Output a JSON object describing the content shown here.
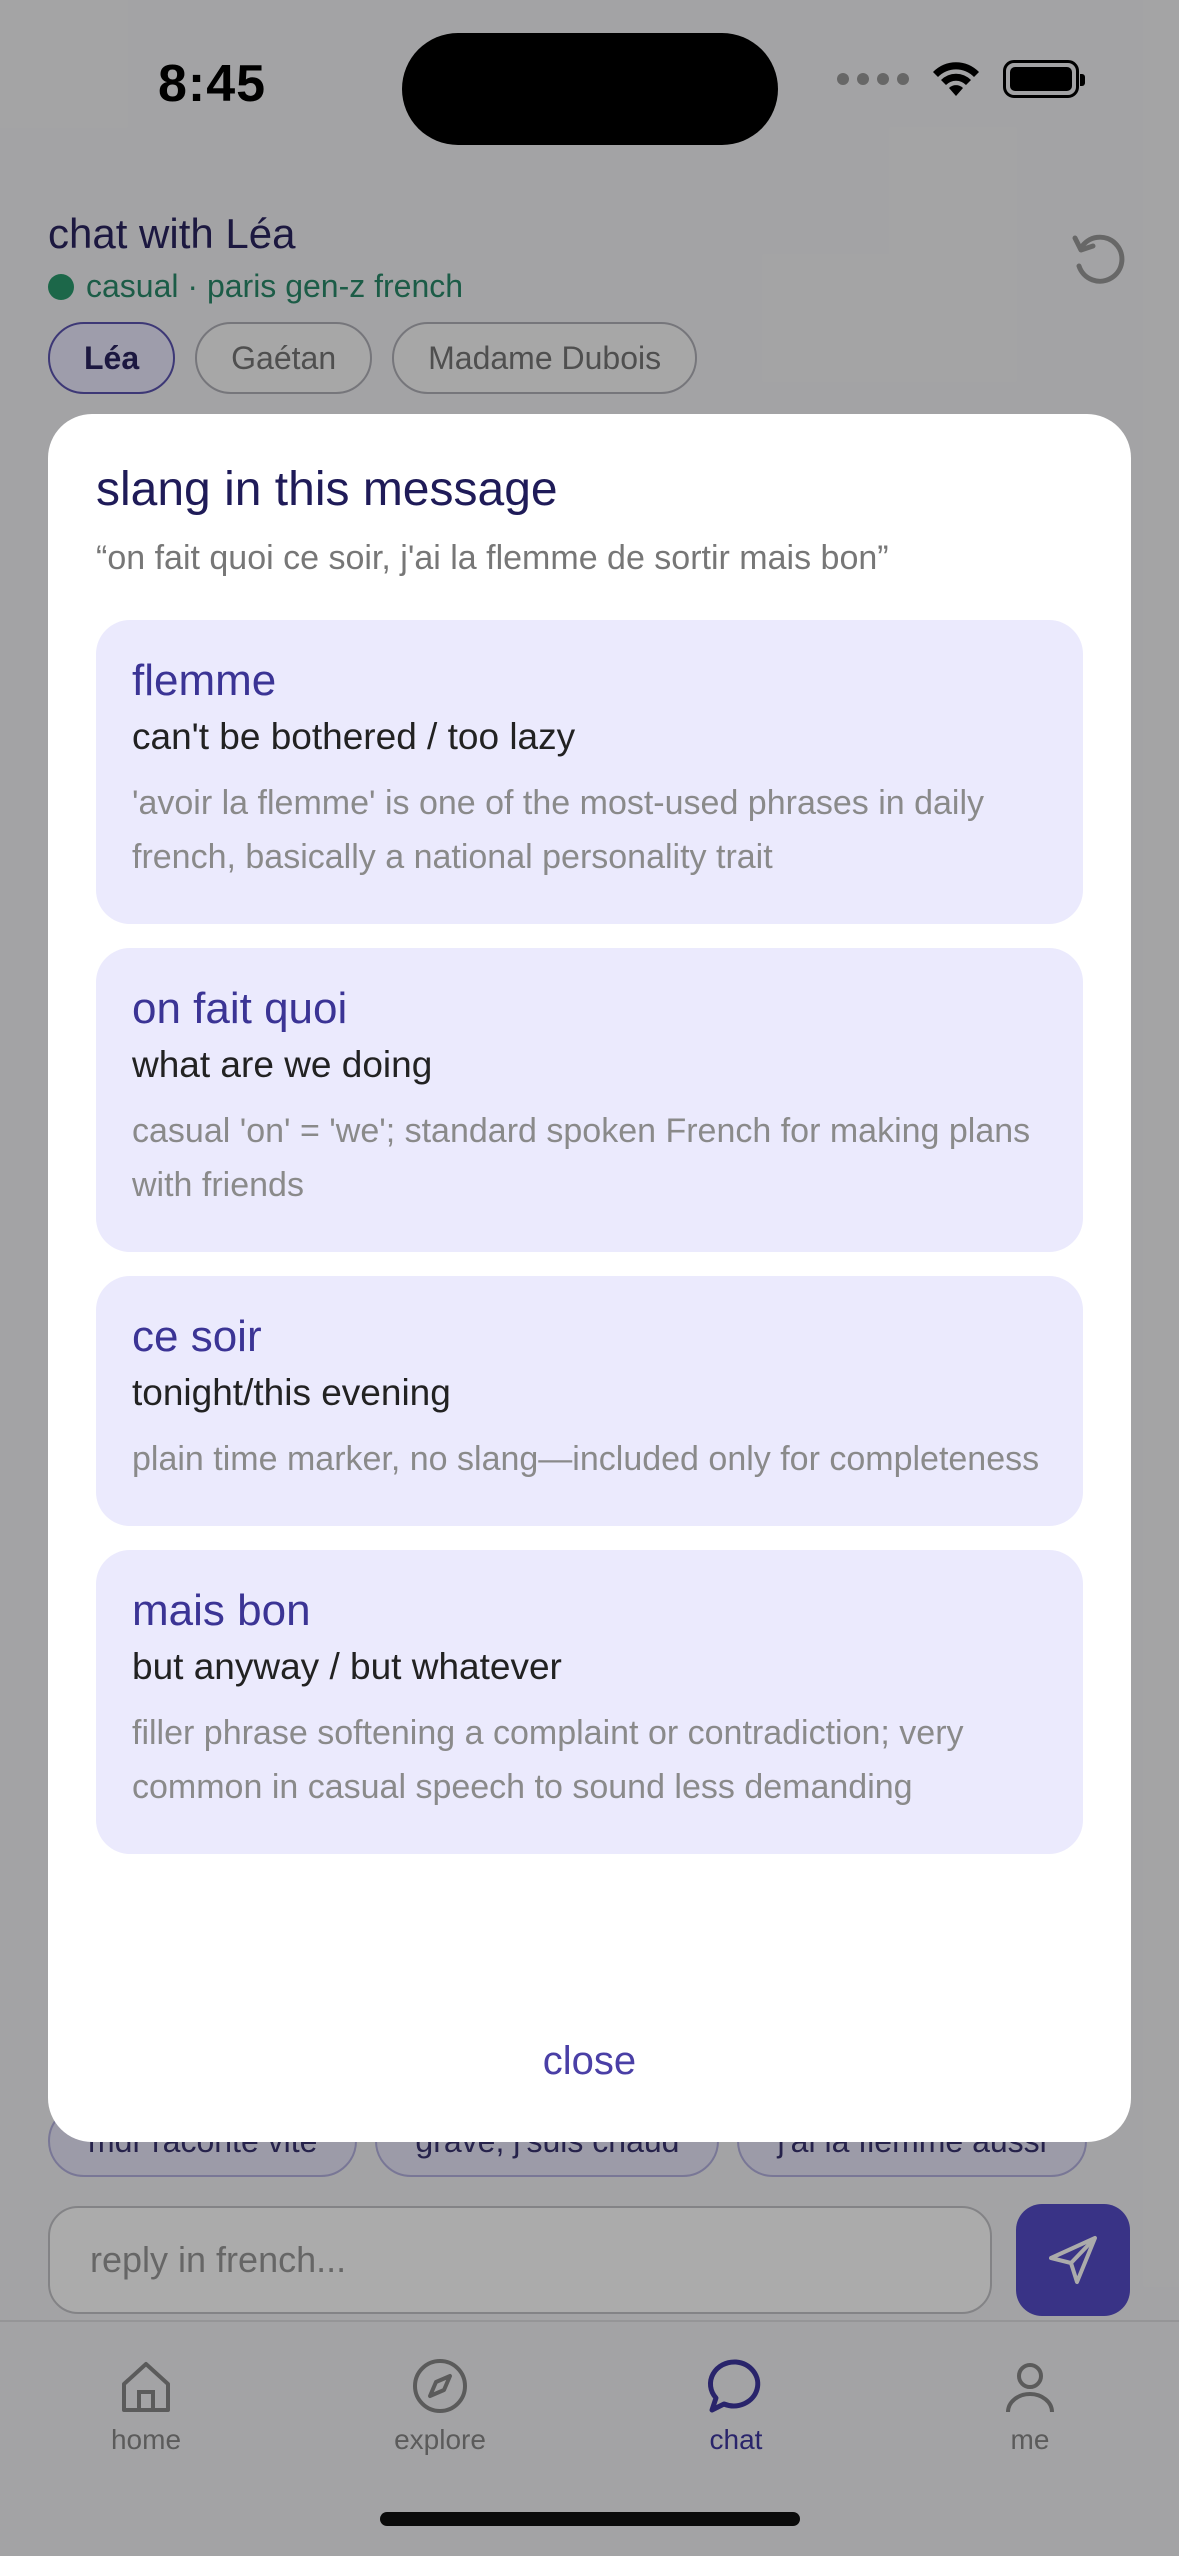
{
  "status_bar": {
    "time": "8:45"
  },
  "chat": {
    "title": "chat with Léa",
    "subtitle": "casual · paris gen-z french",
    "personas": [
      "Léa",
      "Gaétan",
      "Madame Dubois"
    ]
  },
  "suggestions": [
    "mdr raconte vite",
    "grave, j'suis chaud",
    "j'ai la flemme aussi"
  ],
  "composer": {
    "placeholder": "reply in french..."
  },
  "tabs": [
    {
      "label": "home",
      "icon": "home-icon"
    },
    {
      "label": "explore",
      "icon": "compass-icon"
    },
    {
      "label": "chat",
      "icon": "chat-bubble-icon"
    },
    {
      "label": "me",
      "icon": "person-icon"
    }
  ],
  "active_tab": "chat",
  "modal": {
    "title": "slang in this message",
    "quote": "“on fait quoi ce soir, j'ai la flemme de sortir mais bon”",
    "items": [
      {
        "term": "flemme",
        "meaning": "can't be bothered / too lazy",
        "note": "'avoir la flemme' is one of the most-used phrases in daily french, basically a national personality trait"
      },
      {
        "term": "on fait quoi",
        "meaning": "what are we doing",
        "note": "casual 'on' = 'we'; standard spoken French for making plans with friends"
      },
      {
        "term": "ce soir",
        "meaning": "tonight/this evening",
        "note": "plain time marker, no slang—included only for completeness"
      },
      {
        "term": "mais bon",
        "meaning": "but anyway / but whatever",
        "note": "filler phrase softening a complaint or contradiction; very common in casual speech to sound less demanding"
      }
    ],
    "close_label": "close"
  },
  "colors": {
    "accent": "#564cc8",
    "online": "#2a9a6e",
    "card_bg": "#ebeafd"
  }
}
